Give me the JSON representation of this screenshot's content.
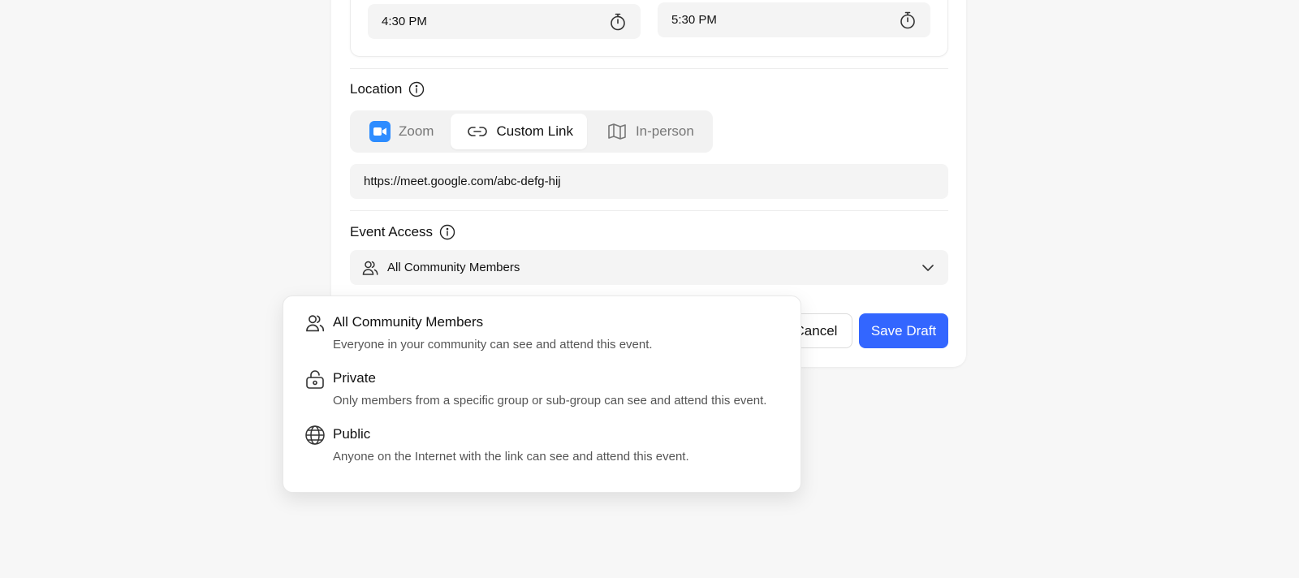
{
  "time": {
    "start": "4:30 PM",
    "end": "5:30 PM"
  },
  "location": {
    "label": "Location",
    "tabs": [
      {
        "label": "Zoom",
        "icon": "zoom-icon"
      },
      {
        "label": "Custom Link",
        "icon": "link-icon",
        "selected": true
      },
      {
        "label": "In-person",
        "icon": "map-icon"
      }
    ],
    "url_value": "https://meet.google.com/abc-defg-hij"
  },
  "access": {
    "label": "Event Access",
    "selected": "All Community Members",
    "options": [
      {
        "title": "All Community Members",
        "description": "Everyone in your community can see and attend this event.",
        "icon": "users-icon"
      },
      {
        "title": "Private",
        "description": "Only members from a specific group or sub-group can see and attend this event.",
        "icon": "lock-icon"
      },
      {
        "title": "Public",
        "description": "Anyone on the Internet with the link can see and attend this event.",
        "icon": "globe-icon"
      }
    ]
  },
  "actions": {
    "cancel_label": "Cancel",
    "save_label": "Save Draft"
  },
  "colors": {
    "primary": "#3366ff",
    "zoom": "#2d8cff",
    "background": "#f7f7f7"
  }
}
